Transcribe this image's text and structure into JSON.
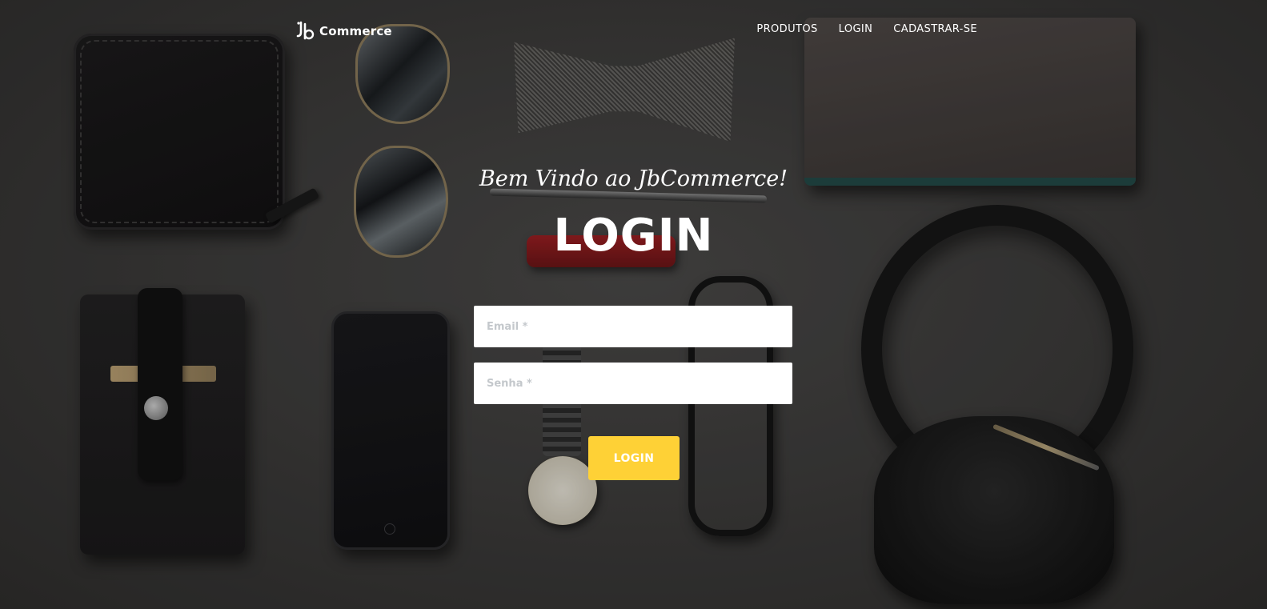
{
  "navbar": {
    "brand_name": "Commerce",
    "brand_icon": "jb-logo",
    "links": [
      {
        "label": "PRODUTOS"
      },
      {
        "label": "LOGIN"
      },
      {
        "label": "CADASTRAR-SE"
      }
    ]
  },
  "hero": {
    "welcome_text": "Bem Vindo ao JbCommerce!",
    "title": "LOGIN"
  },
  "form": {
    "email": {
      "placeholder": "Email *",
      "value": ""
    },
    "password": {
      "placeholder": "Senha *",
      "value": ""
    },
    "submit_label": "LOGIN"
  },
  "colors": {
    "accent": "#fed136",
    "background": "#3a3939",
    "text": "#ffffff"
  }
}
